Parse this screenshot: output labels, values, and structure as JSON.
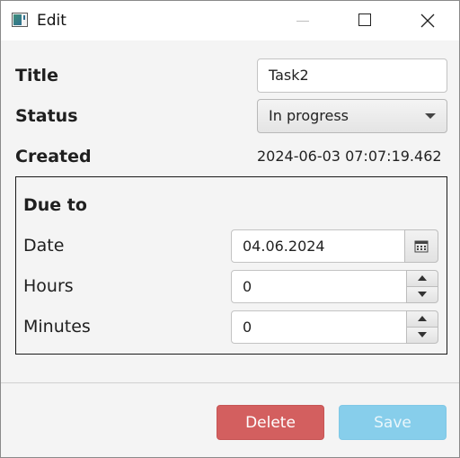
{
  "window": {
    "title": "Edit",
    "icons": {
      "app": "app-window-icon",
      "minimize": "minimize-icon",
      "maximize": "maximize-icon",
      "close": "close-icon"
    }
  },
  "form": {
    "title_label": "Title",
    "title_value": "Task2",
    "status_label": "Status",
    "status_value": "In progress",
    "created_label": "Created",
    "created_value": "2024-06-03 07:07:19.462"
  },
  "due": {
    "heading": "Due to",
    "date_label": "Date",
    "date_value": "04.06.2024",
    "hours_label": "Hours",
    "hours_value": "0",
    "minutes_label": "Minutes",
    "minutes_value": "0",
    "icons": {
      "calendar": "calendar-icon",
      "spin_up": "arrow-up-icon",
      "spin_down": "arrow-down-icon",
      "dropdown": "chevron-down-icon"
    }
  },
  "actions": {
    "delete_label": "Delete",
    "save_label": "Save"
  },
  "colors": {
    "delete": "#d35f5f",
    "save": "#87ceeb",
    "background": "#f4f4f4"
  }
}
